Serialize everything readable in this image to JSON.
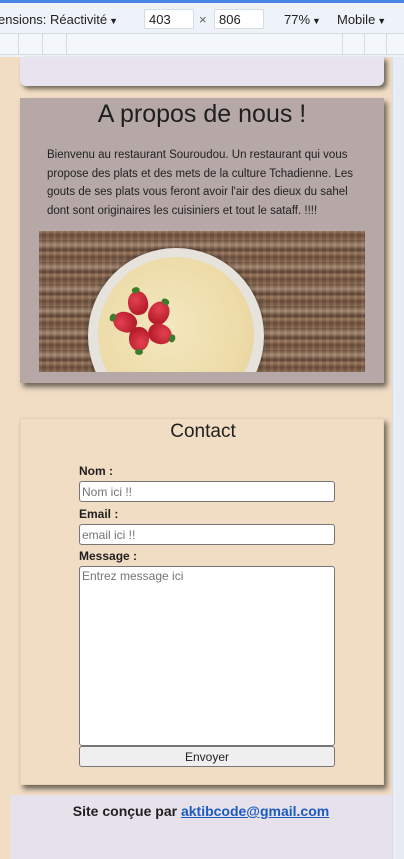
{
  "devtools": {
    "dimensions_label": "ensions: Réactivité",
    "width_value": "403",
    "times": "×",
    "height_value": "806",
    "zoom": "77%",
    "mode": "Mobile"
  },
  "about": {
    "title": "A propos de nous !",
    "text": "Bienvenu au restaurant Souroudou. Un restaurant qui vous propose des plats et des mets de la culture Tchadienne. Les gouts de ses plats vous feront avoir l'air des dieux du sahel dont sont originaires les cuisiniers et tout le sataff. !!!!"
  },
  "contact": {
    "title": "Contact",
    "name_label": "Nom :",
    "name_placeholder": "Nom ici !!",
    "email_label": "Email :",
    "email_placeholder": "email ici !!",
    "message_label": "Message :",
    "message_placeholder": "Entrez message ici",
    "submit_label": "Envoyer"
  },
  "footer": {
    "prefix": "Site conçue par",
    "email_link": "aktibcode@gmail.com"
  },
  "colors": {
    "page_bg": "#f1dcc4",
    "about_card": "#b5a8a6",
    "footer_bg": "#e7e1ec",
    "link": "#1a5bbf",
    "devtools_accent": "#4b84e6"
  }
}
